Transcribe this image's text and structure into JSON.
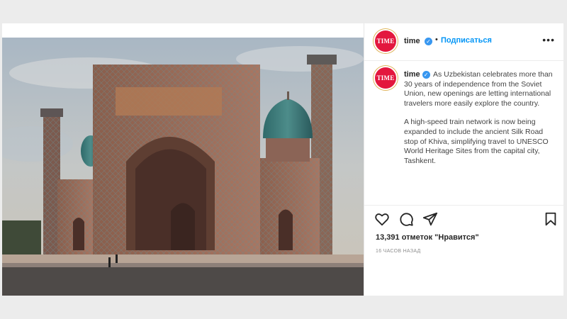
{
  "post": {
    "image_alt": "Sher-Dor Madrasah, Registan, Samarkand",
    "account": {
      "avatar_text": "TIME",
      "username": "time",
      "follow_label": "Подписаться",
      "more_glyph": "•••"
    },
    "caption": {
      "username": "time",
      "paragraph1": "As Uzbekistan celebrates more than 30 years of independence from the Soviet Union, new openings are letting international travelers more easily explore the country.",
      "paragraph2": "A high-speed train network is now being expanded to include the ancient Silk Road stop of Khiva, simplifying travel to UNESCO World Heritage Sites from the capital city, Tashkent."
    },
    "actions": {
      "like_icon": "heart-icon",
      "comment_icon": "comment-icon",
      "share_icon": "paper-plane-icon",
      "save_icon": "bookmark-icon"
    },
    "likes_text": "13,391 отметок \"Нравится\"",
    "timestamp": "16 ЧАСОВ НАЗАД"
  },
  "colors": {
    "brand_red": "#e3173e",
    "link_blue": "#0095f6",
    "verified_blue": "#3897f0"
  }
}
